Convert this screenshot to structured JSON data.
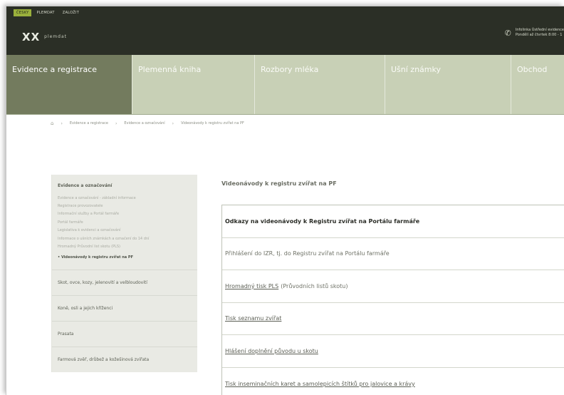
{
  "top_tabs": [
    "ČESKY",
    "PLEMDAT",
    "ZALOŽIT"
  ],
  "brand": {
    "logo": "XX",
    "tagline": "plemdat"
  },
  "contact": {
    "line1": "Infolinka Ústřední evidence",
    "line2": "Pondělí až čtvrtek 8:00 - 1"
  },
  "nav": [
    {
      "label": "Evidence a registrace",
      "active": true
    },
    {
      "label": "Plemenná kniha",
      "active": false
    },
    {
      "label": "Rozbory mléka",
      "active": false
    },
    {
      "label": "Ušní známky",
      "active": false
    },
    {
      "label": "Obchod",
      "active": false
    }
  ],
  "breadcrumb": {
    "items": [
      "Evidence a registrace",
      "Evidence a označování",
      "Videonávody k registru zvířat na PF"
    ]
  },
  "sidebar": {
    "heading": "Evidence a označování",
    "items": [
      "Evidence a označování - základní informace",
      "Registrace provozovatele",
      "Informační služby a Portál farmáře",
      "Portál farmáře",
      "Legislativa k evidenci a označování",
      "Informace o ušních známkách a označení do 14 dní",
      "Hromadný Průvodní list skotu (PLS)",
      "Videonávody k registru zvířat na PF"
    ],
    "groups": [
      "Skot, ovce, kozy, jelenovití a velbloudovití",
      "Koně, osli a jejich kříženci",
      "Prasata",
      "Farmová zvěř, drůbež a kožešinová zvířata"
    ]
  },
  "content": {
    "title": "Videonávody k registru zvířat na PF",
    "rows": [
      {
        "text": "Odkazy na videonávody k Registru zvířat na Portálu farmáře",
        "type": "bold"
      },
      {
        "text": "Přihlášení do IZR, tj. do Registru zvířat na Portálu farmáře",
        "type": "plain"
      },
      {
        "link": "Hromadný tisk PLS",
        "rest": "(Průvodních listů skotu)",
        "type": "link"
      },
      {
        "link": "Tisk seznamu zvířat",
        "type": "link"
      },
      {
        "link": "Hlášení doplnění původu u skotu",
        "type": "link"
      },
      {
        "link": "Tisk inseminačních karet a samolepicích štítků pro jalovice a krávy",
        "type": "link"
      }
    ]
  }
}
